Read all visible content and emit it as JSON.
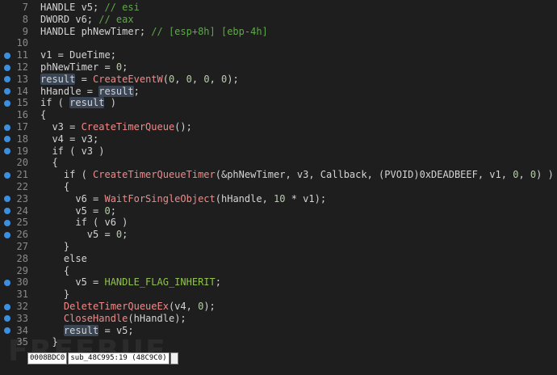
{
  "code_lines": [
    {
      "n": "7",
      "bp": false,
      "tokens": [
        {
          "t": "HANDLE v5; "
        },
        {
          "t": "// esi",
          "c": "cm"
        }
      ]
    },
    {
      "n": "8",
      "bp": false,
      "tokens": [
        {
          "t": "DWORD v6; "
        },
        {
          "t": "// eax",
          "c": "cm"
        }
      ]
    },
    {
      "n": "9",
      "bp": false,
      "tokens": [
        {
          "t": "HANDLE phNewTimer; "
        },
        {
          "t": "// [esp+8h] [ebp-4h]",
          "c": "cm"
        }
      ]
    },
    {
      "n": "10",
      "bp": false,
      "tokens": [
        {
          "t": ""
        }
      ]
    },
    {
      "n": "11",
      "bp": true,
      "tokens": [
        {
          "t": "v1 = DueTime;"
        }
      ]
    },
    {
      "n": "12",
      "bp": true,
      "tokens": [
        {
          "t": "phNewTimer = "
        },
        {
          "t": "0",
          "c": "num"
        },
        {
          "t": ";"
        }
      ]
    },
    {
      "n": "13",
      "bp": true,
      "tokens": [
        {
          "t": "result",
          "c": "hl"
        },
        {
          "t": " = "
        },
        {
          "t": "CreateEventW",
          "c": "fn"
        },
        {
          "t": "("
        },
        {
          "t": "0",
          "c": "num"
        },
        {
          "t": ", "
        },
        {
          "t": "0",
          "c": "num"
        },
        {
          "t": ", "
        },
        {
          "t": "0",
          "c": "num"
        },
        {
          "t": ", "
        },
        {
          "t": "0",
          "c": "num"
        },
        {
          "t": ");"
        }
      ]
    },
    {
      "n": "14",
      "bp": true,
      "tokens": [
        {
          "t": "hHandle = "
        },
        {
          "t": "result",
          "c": "hl"
        },
        {
          "t": ";"
        }
      ]
    },
    {
      "n": "15",
      "bp": true,
      "tokens": [
        {
          "t": "if ( "
        },
        {
          "t": "result",
          "c": "hl"
        },
        {
          "t": " )"
        }
      ]
    },
    {
      "n": "16",
      "bp": false,
      "tokens": [
        {
          "t": "{"
        }
      ]
    },
    {
      "n": "17",
      "bp": true,
      "tokens": [
        {
          "t": "  v3 = "
        },
        {
          "t": "CreateTimerQueue",
          "c": "fn"
        },
        {
          "t": "();"
        }
      ]
    },
    {
      "n": "18",
      "bp": true,
      "tokens": [
        {
          "t": "  v4 = v3;"
        }
      ]
    },
    {
      "n": "19",
      "bp": true,
      "tokens": [
        {
          "t": "  if ( v3 )"
        }
      ]
    },
    {
      "n": "20",
      "bp": false,
      "tokens": [
        {
          "t": "  {"
        }
      ]
    },
    {
      "n": "21",
      "bp": true,
      "tokens": [
        {
          "t": "    if ( "
        },
        {
          "t": "CreateTimerQueueTimer",
          "c": "fn"
        },
        {
          "t": "(&phNewTimer, v3, Callback, (PVOID)0xDEADBEEF, v1, "
        },
        {
          "t": "0",
          "c": "num"
        },
        {
          "t": ", "
        },
        {
          "t": "0",
          "c": "num"
        },
        {
          "t": ") )"
        }
      ]
    },
    {
      "n": "22",
      "bp": false,
      "tokens": [
        {
          "t": "    {"
        }
      ]
    },
    {
      "n": "23",
      "bp": true,
      "tokens": [
        {
          "t": "      v6 = "
        },
        {
          "t": "WaitForSingleObject",
          "c": "fn"
        },
        {
          "t": "(hHandle, "
        },
        {
          "t": "10",
          "c": "num"
        },
        {
          "t": " * v1);"
        }
      ]
    },
    {
      "n": "24",
      "bp": true,
      "tokens": [
        {
          "t": "      v5 = "
        },
        {
          "t": "0",
          "c": "num"
        },
        {
          "t": ";"
        }
      ]
    },
    {
      "n": "25",
      "bp": true,
      "tokens": [
        {
          "t": "      if ( v6 )"
        }
      ]
    },
    {
      "n": "26",
      "bp": true,
      "tokens": [
        {
          "t": "        v5 = "
        },
        {
          "t": "0",
          "c": "num"
        },
        {
          "t": ";"
        }
      ]
    },
    {
      "n": "27",
      "bp": false,
      "tokens": [
        {
          "t": "    }"
        }
      ]
    },
    {
      "n": "28",
      "bp": false,
      "tokens": [
        {
          "t": "    else"
        }
      ]
    },
    {
      "n": "29",
      "bp": false,
      "tokens": [
        {
          "t": "    {"
        }
      ]
    },
    {
      "n": "30",
      "bp": true,
      "tokens": [
        {
          "t": "      v5 = "
        },
        {
          "t": "HANDLE_FLAG_INHERIT",
          "c": "const"
        },
        {
          "t": ";"
        }
      ]
    },
    {
      "n": "31",
      "bp": false,
      "tokens": [
        {
          "t": "    }"
        }
      ]
    },
    {
      "n": "32",
      "bp": true,
      "tokens": [
        {
          "t": "    "
        },
        {
          "t": "DeleteTimerQueueEx",
          "c": "fn"
        },
        {
          "t": "(v4, "
        },
        {
          "t": "0",
          "c": "num"
        },
        {
          "t": ");"
        }
      ]
    },
    {
      "n": "33",
      "bp": true,
      "tokens": [
        {
          "t": "    "
        },
        {
          "t": "CloseHandle",
          "c": "fn"
        },
        {
          "t": "(hHandle);"
        }
      ]
    },
    {
      "n": "34",
      "bp": true,
      "tokens": [
        {
          "t": "    "
        },
        {
          "t": "result",
          "c": "hl"
        },
        {
          "t": " = v5;"
        }
      ]
    },
    {
      "n": "35",
      "bp": false,
      "tokens": [
        {
          "t": "  }"
        }
      ]
    }
  ],
  "status": {
    "address": "0008BDC0",
    "location": "sub_48C995:19 (48C9C0)"
  },
  "watermark": "FREEBUF",
  "colors": {
    "background": "#1e1e1e",
    "breakpoint": "#3b8fe0",
    "function": "#f08a8a",
    "comment": "#5fa84a",
    "constant": "#8fc34a"
  }
}
